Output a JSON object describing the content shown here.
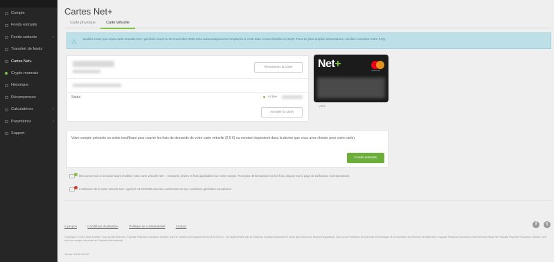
{
  "nav": [
    {
      "label": "Compte",
      "icon": "account-icon",
      "chevron": false,
      "dot": false
    },
    {
      "label": "Fonds entrants",
      "icon": "deposit-icon",
      "chevron": false,
      "dot": false
    },
    {
      "label": "Fonds sortants",
      "icon": "withdraw-icon",
      "chevron": true,
      "dot": false
    },
    {
      "label": "Transfert de fonds",
      "icon": "transfer-icon",
      "chevron": false,
      "dot": false
    },
    {
      "label": "Cartes Net+",
      "icon": "card-icon",
      "chevron": false,
      "dot": false
    },
    {
      "label": "Crypto monnaie",
      "icon": "crypto-icon",
      "chevron": false,
      "dot": true
    },
    {
      "label": "Historique",
      "icon": "history-icon",
      "chevron": false,
      "dot": false
    },
    {
      "label": "Récompenses",
      "icon": "rewards-icon",
      "chevron": false,
      "dot": false
    },
    {
      "label": "Calculatrices",
      "icon": "calculator-icon",
      "chevron": true,
      "dot": false
    },
    {
      "label": "Paramètres",
      "icon": "settings-icon",
      "chevron": true,
      "dot": false
    },
    {
      "label": "Support",
      "icon": "support-icon",
      "chevron": false,
      "dot": false
    }
  ],
  "page": {
    "title": "Cartes Net+",
    "tabs": [
      "Carte physique",
      "Carte virtuelle"
    ]
  },
  "alert": {
    "text": "Veuillez noter que toute carte virtuelle Net+ générée avant le 10 novembre 2020 sera automatiquement remplacée à cette date et sera libellée en EUR. Pour de plus amples informations, veuillez consulter notre FAQ."
  },
  "card_panel": {
    "rename_button": "Renommer la carte",
    "status_label": "Statut",
    "status_value": "Active",
    "cancel_button": "Annuler la carte"
  },
  "netcard": {
    "brand": "Net",
    "brand_plus": "+",
    "network": "mastercard",
    "caption": "Voilà"
  },
  "balance": {
    "text": "Votre compte présente un solde insuffisant pour couvrir les frais de demande de votre carte virtuelle (2,5 €) ou montant équivalent dans la devise que vous avez choisie pour votre carte).",
    "button": "Fonds entrants"
  },
  "notes": [
    {
      "text": "Découvrez tout ce à savoir avant d'utiliser votre carte virtuelle Net+ : montants, limites et frais applicables sur votre compte. Pour plus d'informations sur les frais, cliquez sur la page de tarification correspondante.",
      "badge_color": "#7fc142"
    },
    {
      "text": "L'utilisation de la carte virtuelle Net+ après le 31.03.2019 aura lieu conformément aux conditions générales actualisées.",
      "badge_color": "#d9342b"
    }
  ],
  "footer": {
    "links": [
      "À propos",
      "Conditions d'utilisation",
      "Politique de confidentialité",
      "Contact"
    ],
    "copyright": "Copyright © 2019 Skrill Limited. Tous droits réservés. Paysafe Payment Solutions Limited, dont le numéro d'enregistrement est 03732727, est réglementée par la Financial Conduct Authority en vertu des Electronic Money Regulations 2011 pour l'émission de monnaie électronique et la fourniture de services de paiement. Paysafe Financial Services Limited est une filiale de Paysafe Payment Solutions Limited. Net+ est une marque déposée de Paysafe International.",
    "version": "Version 19.06.04.007"
  },
  "colors": {
    "accent": "#7fc142",
    "button_green": "#6cae3a",
    "sidebar": "#262626",
    "alert_bg": "#bde0e8"
  }
}
